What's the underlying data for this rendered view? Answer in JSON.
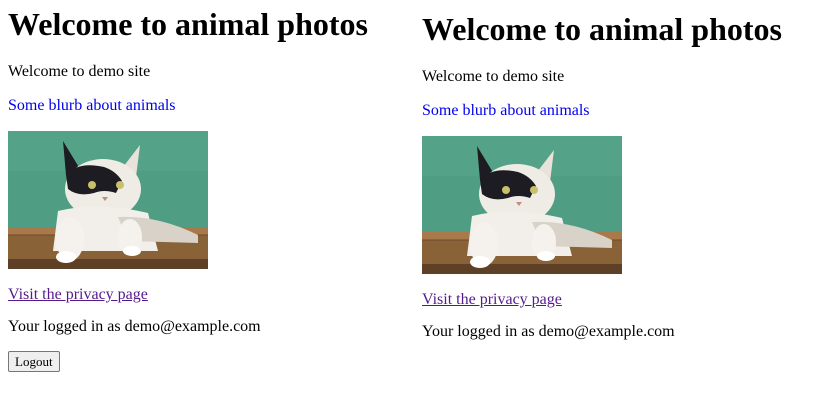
{
  "panels": [
    {
      "heading": "Welcome to animal photos",
      "intro": "Welcome to demo site",
      "blurb": "Some blurb about animals",
      "privacy_link": "Visit the privacy page",
      "logged_in": "Your logged in as demo@example.com",
      "logout_label": "Logout"
    },
    {
      "heading": "Welcome to animal photos",
      "intro": "Welcome to demo site",
      "blurb": "Some blurb about animals",
      "privacy_link": "Visit the privacy page",
      "logged_in": "Your logged in as demo@example.com"
    }
  ],
  "photo": {
    "icon": "cat-photo",
    "colors": {
      "background": "#4f9e84",
      "fence": "#8a6238",
      "fur_dark": "#1c1c22",
      "fur_light": "#efece6"
    }
  }
}
